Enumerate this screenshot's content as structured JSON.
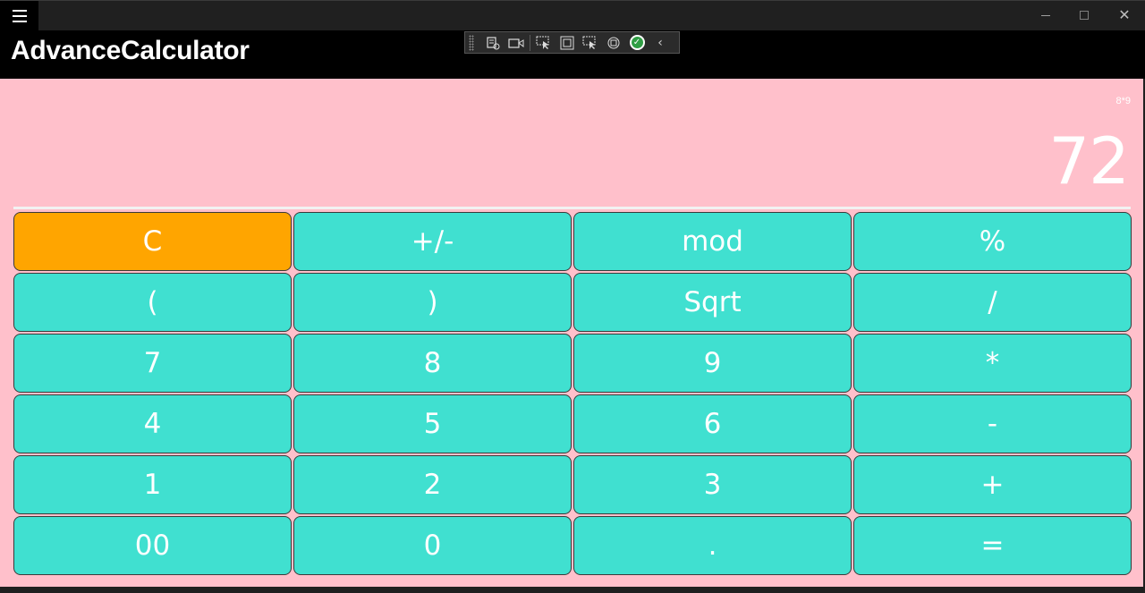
{
  "app": {
    "title": "AdvanceCalculator"
  },
  "window": {
    "minimize_icon": "minimize-icon",
    "maximize_icon": "maximize-icon",
    "close_icon": "close-icon"
  },
  "debug_toolbar": {
    "icons": [
      "live-visual-tree-icon",
      "record-icon",
      "select-element-icon",
      "display-layout-adorners-icon",
      "track-focus-icon",
      "hot-reload-icon",
      "xaml-ok-icon",
      "collapse-chevron-icon"
    ]
  },
  "display": {
    "expression": "8*9",
    "result": "72"
  },
  "keys": [
    [
      "C",
      "+/-",
      "mod",
      "%"
    ],
    [
      "(",
      ")",
      "Sqrt",
      "/"
    ],
    [
      "7",
      "8",
      "9",
      "*"
    ],
    [
      "4",
      "5",
      "6",
      "-"
    ],
    [
      "1",
      "2",
      "3",
      "+"
    ],
    [
      "00",
      "0",
      ".",
      "="
    ]
  ],
  "colors": {
    "background": "#ffc0cb",
    "key": "#40e0d0",
    "clear_key": "#ffa500",
    "text": "#ffffff",
    "header": "#000000"
  }
}
